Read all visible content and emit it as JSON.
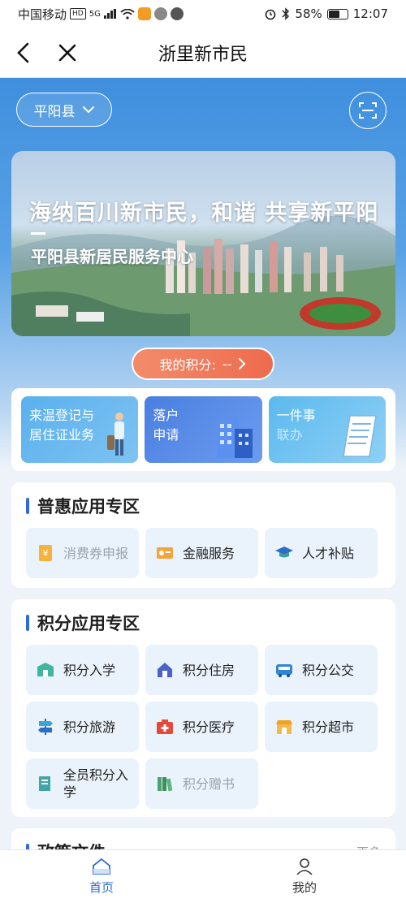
{
  "status_bar": {
    "carrier": "中国移动",
    "hd": "HD",
    "network": "5G",
    "battery": "58%",
    "time": "12:07"
  },
  "nav": {
    "title": "浙里新市民"
  },
  "region": {
    "label": "平阳县"
  },
  "banner": {
    "slogan": "海纳百川新市民，和谐 共享新平阳",
    "subtitle": "平阳县新居民服务中心"
  },
  "points": {
    "label": "我的积分:",
    "value": "--"
  },
  "quick": [
    {
      "line1": "来温登记与",
      "line2": "居住证业务"
    },
    {
      "line1": "落户",
      "line2": "申请"
    },
    {
      "line1": "一件事",
      "line2": "联办"
    }
  ],
  "sections": {
    "welfare": {
      "title": "普惠应用专区",
      "items": [
        {
          "label": "消费券申报",
          "icon": "coupon-icon"
        },
        {
          "label": "金融服务",
          "icon": "finance-icon"
        },
        {
          "label": "人才补贴",
          "icon": "graduation-cap-icon"
        }
      ]
    },
    "points_apps": {
      "title": "积分应用专区",
      "items": [
        {
          "label": "积分入学",
          "icon": "school-icon"
        },
        {
          "label": "积分住房",
          "icon": "house-icon"
        },
        {
          "label": "积分公交",
          "icon": "bus-icon"
        },
        {
          "label": "积分旅游",
          "icon": "signpost-icon"
        },
        {
          "label": "积分医疗",
          "icon": "medical-kit-icon"
        },
        {
          "label": "积分超市",
          "icon": "shop-icon"
        },
        {
          "label": "全员积分入学",
          "icon": "book-icon"
        },
        {
          "label": "积分赠书",
          "icon": "books-icon"
        }
      ]
    },
    "policy": {
      "title": "政策文件",
      "more": "更多"
    }
  },
  "tabs": [
    {
      "label": "首页",
      "icon": "home-icon"
    },
    {
      "label": "我的",
      "icon": "user-icon"
    }
  ],
  "colors": {
    "primary": "#2e6bd6",
    "hero_top": "#3f8fde",
    "points_pill": "#ee6b4d"
  }
}
